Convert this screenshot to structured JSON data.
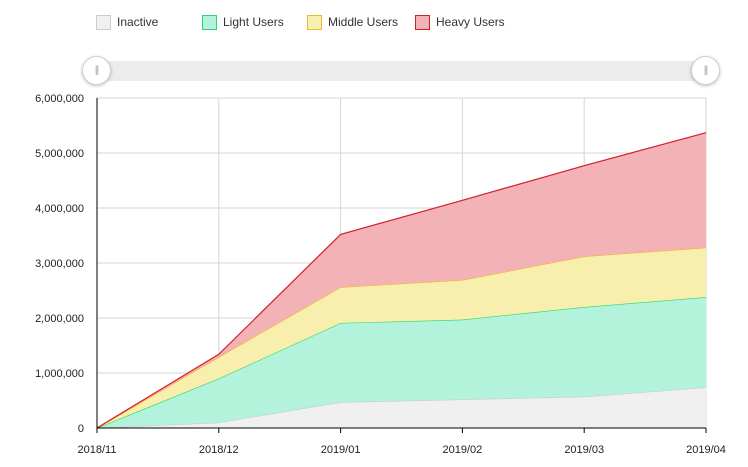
{
  "legend": [
    {
      "label": "Inactive",
      "fill": "#f0f0f0",
      "stroke": "#cccccc"
    },
    {
      "label": "Light Users",
      "fill": "#b3f3dc",
      "stroke": "#2bd66c"
    },
    {
      "label": "Middle Users",
      "fill": "#f8efaf",
      "stroke": "#f1b82d"
    },
    {
      "label": "Heavy Users",
      "fill": "#f3b2b6",
      "stroke": "#d21f2c"
    }
  ],
  "chart_data": {
    "type": "area",
    "stacked": true,
    "categories": [
      "2018/11",
      "2018/12",
      "2019/01",
      "2019/02",
      "2019/03",
      "2019/04"
    ],
    "ylim": [
      0,
      6000000
    ],
    "yticks": [
      0,
      1000000,
      2000000,
      3000000,
      4000000,
      5000000,
      6000000
    ],
    "ytick_labels": [
      "0",
      "1,000,000",
      "2,000,000",
      "3,000,000",
      "4,000,000",
      "5,000,000",
      "6,000,000"
    ],
    "grid": true,
    "legend_position": "top",
    "series": [
      {
        "name": "Inactive",
        "values": [
          0,
          100000,
          470000,
          520000,
          570000,
          740000
        ]
      },
      {
        "name": "Light Users",
        "values": [
          0,
          800000,
          1440000,
          1450000,
          1630000,
          1640000
        ]
      },
      {
        "name": "Middle Users",
        "values": [
          0,
          390000,
          650000,
          720000,
          920000,
          900000
        ]
      },
      {
        "name": "Heavy Users",
        "values": [
          0,
          50000,
          960000,
          1450000,
          1650000,
          2090000
        ]
      }
    ]
  },
  "scrollbar": {
    "start_grip": "||",
    "end_grip": "||"
  }
}
